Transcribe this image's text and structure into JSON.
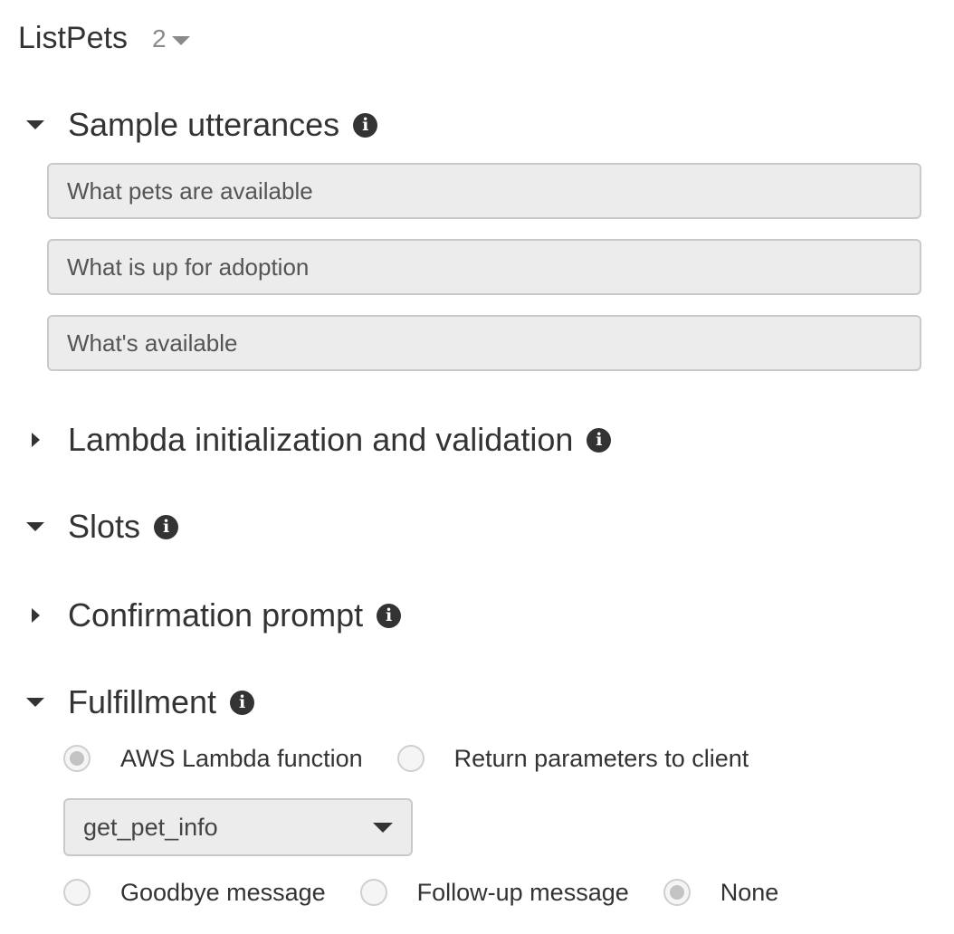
{
  "intent": {
    "name": "ListPets",
    "version": "2"
  },
  "sections": {
    "sample_utterances": {
      "title": "Sample utterances",
      "expanded": true
    },
    "lambda_init": {
      "title": "Lambda initialization and validation",
      "expanded": false
    },
    "slots": {
      "title": "Slots",
      "expanded": true
    },
    "confirmation": {
      "title": "Confirmation prompt",
      "expanded": false
    },
    "fulfillment": {
      "title": "Fulfillment",
      "expanded": true
    }
  },
  "utterances": [
    "What pets are available",
    "What is up for adoption",
    "What's available"
  ],
  "fulfillment": {
    "options": [
      {
        "label": "AWS Lambda function",
        "selected": true
      },
      {
        "label": "Return parameters to client",
        "selected": false
      }
    ],
    "lambda_function": "get_pet_info",
    "message_options": [
      {
        "label": "Goodbye message",
        "selected": false
      },
      {
        "label": "Follow-up message",
        "selected": false
      },
      {
        "label": "None",
        "selected": true
      }
    ]
  },
  "icons": {
    "info": "info-icon",
    "expanded": "caret-down-icon",
    "collapsed": "caret-right-icon"
  }
}
